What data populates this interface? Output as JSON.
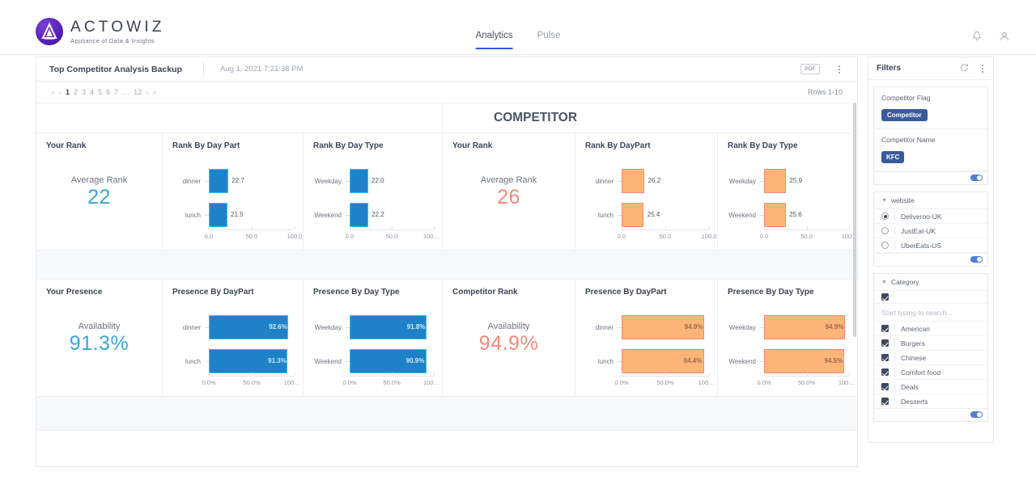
{
  "brand": {
    "name": "ACTOWIZ",
    "tagline": "Appliance of Data & Insights"
  },
  "nav": {
    "items": [
      {
        "label": "Analytics",
        "active": true
      },
      {
        "label": "Pulse",
        "active": false
      }
    ],
    "icons": {
      "bell": "bell-icon",
      "account": "user-icon"
    }
  },
  "board": {
    "title": "Top Competitor Analysis Backup",
    "date": "Aug 1, 2021 7:21:38 PM",
    "export_label": "PDF",
    "pagination": {
      "first": "«",
      "prev": "‹",
      "pages": [
        "1",
        "2",
        "3",
        "4",
        "5",
        "6",
        "7"
      ],
      "ellipsis": "…",
      "last_page": "12",
      "next": "›",
      "last": "»",
      "active_page": "1"
    },
    "rows_label": "Rows 1-10",
    "banner_title": "COMPETITOR"
  },
  "cards": {
    "your_rank": {
      "title": "Your Rank",
      "kpi_label": "Average Rank",
      "kpi_value": "22"
    },
    "rank_by_day_part": {
      "title": "Rank By Day Part"
    },
    "rank_by_day_type": {
      "title": "Rank By Day Type"
    },
    "comp_rank": {
      "title": "Your Rank",
      "kpi_label": "Average Rank",
      "kpi_value": "26"
    },
    "comp_rank_daypart": {
      "title": "Rank By DayPart"
    },
    "comp_rank_daytype": {
      "title": "Rank By Day Type"
    },
    "your_presence": {
      "title": "Your Presence",
      "kpi_label": "Availability",
      "kpi_value": "91.3%"
    },
    "presence_daypart": {
      "title": "Presence By DayPart"
    },
    "presence_daytype": {
      "title": "Presence By Day Type"
    },
    "competitor_rank": {
      "title": "Competitor Rank",
      "kpi_label": "Availability",
      "kpi_value": "94.9%"
    },
    "comp_presence_daypart": {
      "title": "Presence By DayPart"
    },
    "comp_presence_daytype": {
      "title": "Presence By Day Type"
    }
  },
  "chart_data": [
    {
      "id": "rank_by_day_part",
      "type": "bar",
      "orientation": "horizontal",
      "title": "Rank By Day Part",
      "categories": [
        "dinner",
        "lunch"
      ],
      "values": [
        22.7,
        21.5
      ],
      "labels": [
        "22.7",
        "21.5"
      ],
      "ticks": [
        "0.0",
        "50.0",
        "100.0"
      ],
      "xlim": [
        0,
        100
      ],
      "color": "#1f82c8"
    },
    {
      "id": "rank_by_day_type",
      "type": "bar",
      "orientation": "horizontal",
      "title": "Rank By Day Type",
      "categories": [
        "Weekday",
        "Weekend"
      ],
      "values": [
        22.0,
        22.2
      ],
      "labels": [
        "22.0",
        "22.2"
      ],
      "ticks": [
        "0.0",
        "50.0",
        "100…"
      ],
      "xlim": [
        0,
        100
      ],
      "color": "#1f82c8"
    },
    {
      "id": "comp_rank_daypart",
      "type": "bar",
      "orientation": "horizontal",
      "title": "Rank By DayPart",
      "categories": [
        "dinner",
        "lunch"
      ],
      "values": [
        26.2,
        25.4
      ],
      "labels": [
        "26.2",
        "25.4"
      ],
      "ticks": [
        "0.0",
        "50.0",
        "100.0"
      ],
      "xlim": [
        0,
        100
      ],
      "color": "#fcb577"
    },
    {
      "id": "comp_rank_daytype",
      "type": "bar",
      "orientation": "horizontal",
      "title": "Rank By Day Type",
      "categories": [
        "Weekday",
        "Weekend"
      ],
      "values": [
        25.9,
        25.6
      ],
      "labels": [
        "25.9",
        "25.6"
      ],
      "ticks": [
        "0.0",
        "50.0",
        "100.0"
      ],
      "xlim": [
        0,
        100
      ],
      "color": "#fcb577"
    },
    {
      "id": "presence_daypart",
      "type": "bar",
      "orientation": "horizontal",
      "title": "Presence By DayPart",
      "categories": [
        "dinner",
        "lunch"
      ],
      "values": [
        92.6,
        91.3
      ],
      "labels": [
        "92.6%",
        "91.3%"
      ],
      "ticks": [
        "0.0%",
        "50.0%",
        "100…"
      ],
      "xlim": [
        0,
        100
      ],
      "color": "#1f82c8"
    },
    {
      "id": "presence_daytype",
      "type": "bar",
      "orientation": "horizontal",
      "title": "Presence By Day Type",
      "categories": [
        "Weekday",
        "Weekend"
      ],
      "values": [
        91.8,
        90.9
      ],
      "labels": [
        "91.8%",
        "90.9%"
      ],
      "ticks": [
        "0.0%",
        "50.0%",
        "100…"
      ],
      "xlim": [
        0,
        100
      ],
      "color": "#1f82c8"
    },
    {
      "id": "comp_presence_daypart",
      "type": "bar",
      "orientation": "horizontal",
      "title": "Presence By DayPart",
      "categories": [
        "dinner",
        "lunch"
      ],
      "values": [
        94.9,
        94.4
      ],
      "labels": [
        "94.9%",
        "94.4%"
      ],
      "ticks": [
        "0.0%",
        "50.0%",
        "100…"
      ],
      "xlim": [
        0,
        100
      ],
      "color": "#fcb577"
    },
    {
      "id": "comp_presence_daytype",
      "type": "bar",
      "orientation": "horizontal",
      "title": "Presence By Day Type",
      "categories": [
        "Weekday",
        "Weekend"
      ],
      "values": [
        94.9,
        94.5
      ],
      "labels": [
        "94.9%",
        "94.5%"
      ],
      "ticks": [
        "0.0%",
        "50.0%",
        "100…"
      ],
      "xlim": [
        0,
        100
      ],
      "color": "#fcb577"
    }
  ],
  "filters": {
    "title": "Filters",
    "competitor_flag": {
      "label": "Competitor Flag",
      "chip": "Competitor"
    },
    "competitor_name": {
      "label": "Competitor Name",
      "chip": "KFC"
    },
    "website": {
      "label": "website",
      "options": [
        {
          "label": "Deliveroo-UK",
          "selected": true
        },
        {
          "label": "JustEat-UK",
          "selected": false
        },
        {
          "label": "UberEats-US",
          "selected": false
        }
      ]
    },
    "category": {
      "label": "Category",
      "search_placeholder": "Start typing to search...",
      "select_all": true,
      "options": [
        {
          "label": "American",
          "checked": true
        },
        {
          "label": "Burgers",
          "checked": true
        },
        {
          "label": "Chinese",
          "checked": true
        },
        {
          "label": "Comfort food",
          "checked": true
        },
        {
          "label": "Deals",
          "checked": true
        },
        {
          "label": "Desserts",
          "checked": true
        }
      ]
    }
  }
}
